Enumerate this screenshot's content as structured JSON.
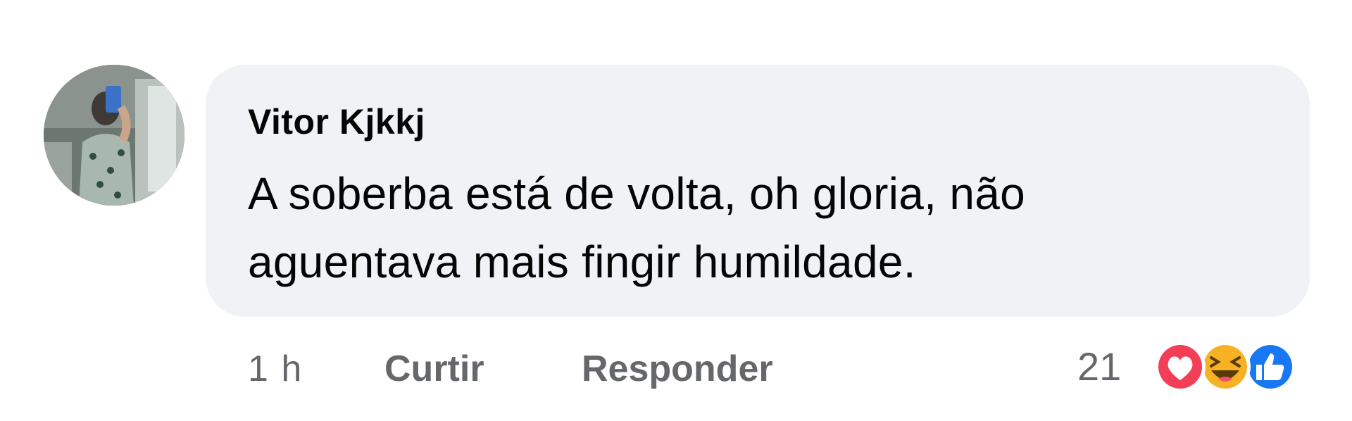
{
  "comment": {
    "author": "Vitor Kjkkj",
    "text_lines": [
      "A soberba está de volta, oh gloria, não",
      "aguentava mais fingir humildade."
    ]
  },
  "actions": {
    "time": "1 h",
    "like_label": "Curtir",
    "reply_label": "Responder"
  },
  "reactions": {
    "count": "21",
    "icons": [
      "love-reaction-icon",
      "haha-reaction-icon",
      "like-reaction-icon"
    ]
  },
  "colors": {
    "bubble": "#f0f2f5",
    "text": "#050505",
    "secondary": "#65676b",
    "love": "#f33e58",
    "haha": "#f7b125",
    "like": "#1877f2"
  }
}
